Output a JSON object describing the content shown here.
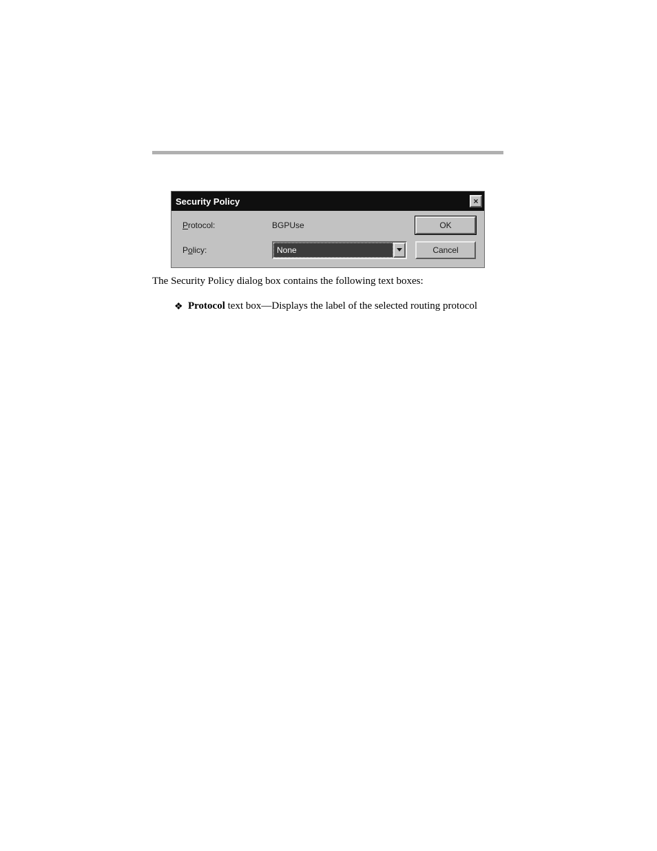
{
  "dialog": {
    "title": "Security Policy",
    "labels": {
      "protocol": "Protocol:",
      "policy": "Policy:"
    },
    "protocol_value": "BGPUse",
    "policy_value": "None",
    "buttons": {
      "ok": "OK",
      "cancel": "Cancel"
    },
    "close_glyph": "×"
  },
  "text": {
    "intro": "The Security Policy dialog box contains the following text boxes:",
    "options": [
      {
        "label": "Protocol",
        "desc": " text box—Displays the label of the selected routing protocol"
      }
    ]
  }
}
